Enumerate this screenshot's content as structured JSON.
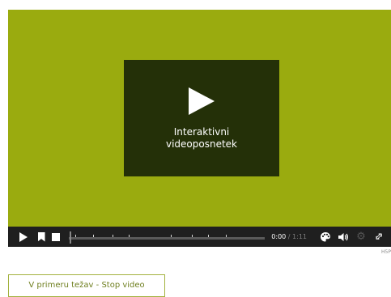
{
  "player": {
    "card_title": "Interaktivni videoposnetek",
    "accent_color": "#9aab0f",
    "card_color": "#243008"
  },
  "controls": {
    "time_current": "0:00",
    "time_separator": " / ",
    "time_total": "1:11",
    "icons": [
      "play-icon",
      "bookmark-icon",
      "stop-icon",
      "palette-icon",
      "volume-icon",
      "gear-icon",
      "fullscreen-icon"
    ]
  },
  "branding": {
    "logo_text": "H5P"
  },
  "action_button": {
    "label": "V primeru težav - Stop video"
  }
}
